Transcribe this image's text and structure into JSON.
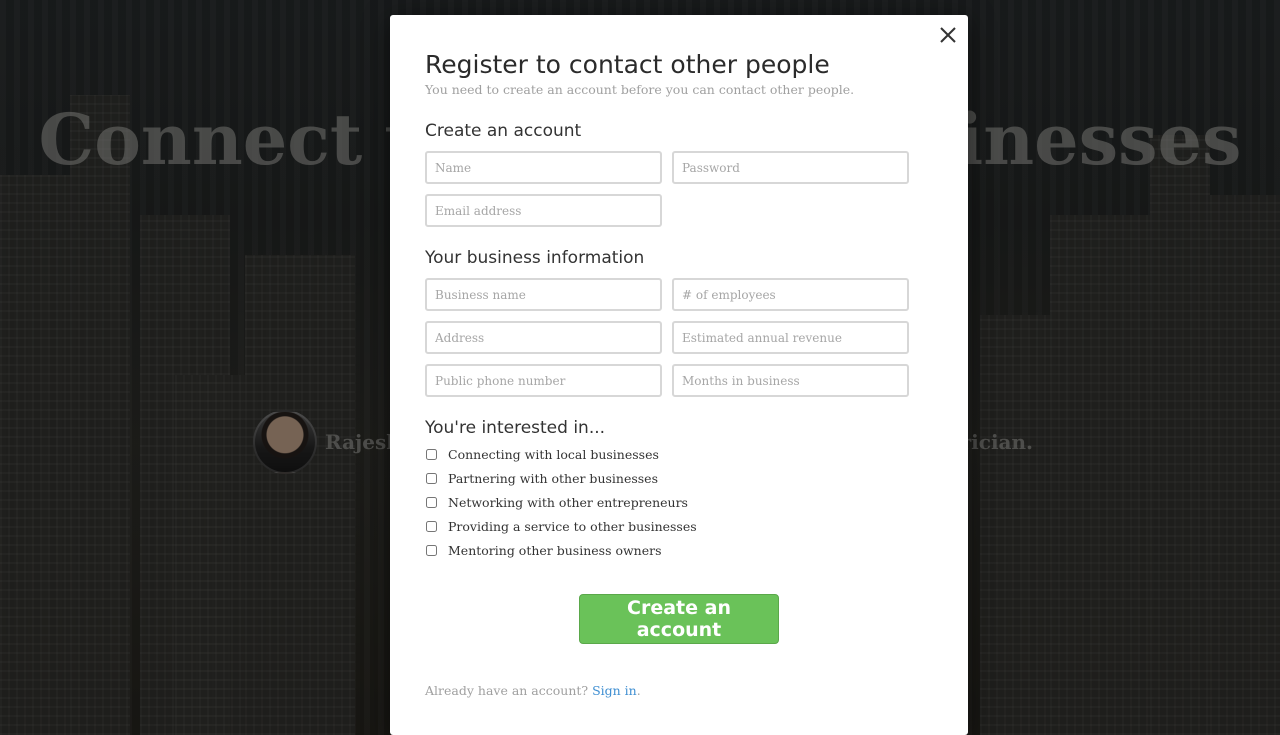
{
  "hero": {
    "title": "Connect with small businesses",
    "testimonial_name": "Rajesh g",
    "testimonial_tail": "rician."
  },
  "modal": {
    "title": "Register to contact other people",
    "subtitle": "You need to create an account before you can contact other people.",
    "close_icon": "close-icon",
    "account_section": {
      "heading": "Create an account",
      "name_placeholder": "Name",
      "password_placeholder": "Password",
      "email_placeholder": "Email address"
    },
    "business_section": {
      "heading": "Your business information",
      "business_name_placeholder": "Business name",
      "employees_placeholder": "# of employees",
      "address_placeholder": "Address",
      "revenue_placeholder": "Estimated annual revenue",
      "phone_placeholder": "Public phone number",
      "months_placeholder": "Months in business"
    },
    "interests_section": {
      "heading": "You're interested in...",
      "options": [
        {
          "label": "Connecting with local businesses",
          "checked": false
        },
        {
          "label": "Partnering with other businesses",
          "checked": false
        },
        {
          "label": "Networking with other entrepreneurs",
          "checked": false
        },
        {
          "label": "Providing a service to other businesses",
          "checked": false
        },
        {
          "label": "Mentoring other business owners",
          "checked": false
        }
      ]
    },
    "submit_label": "Create an account",
    "signin_prompt": "Already have an account?",
    "signin_link": "Sign in",
    "signin_suffix": ".",
    "colors": {
      "primary_button": "#6ac259",
      "link": "#3f8fd2"
    }
  }
}
